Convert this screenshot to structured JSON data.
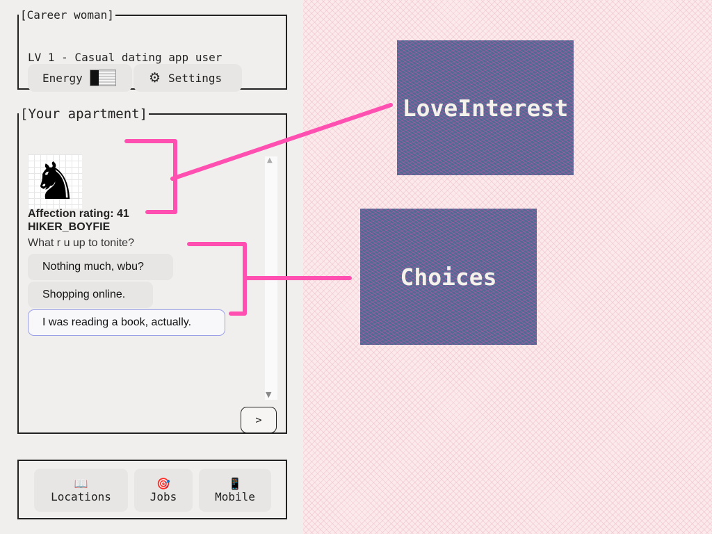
{
  "player": {
    "legend": "[Career woman]",
    "level_text": "LV 1 - Casual dating app user",
    "energy_label": "Energy",
    "energy_level": 0.35,
    "settings_label": "Settings",
    "settings_icon": "gear-icon"
  },
  "apartment": {
    "legend": "[Your apartment]",
    "avatar_icon": "chess-knight-icon",
    "avatar_glyph": "♞",
    "affection_text": "Affection rating: 41",
    "love_interest_name": "HIKER_BOYFIE",
    "message": "What r u up to tonite?",
    "choices": [
      {
        "label": "Nothing much, wbu?",
        "selected": false
      },
      {
        "label": "Shopping online.",
        "selected": false
      },
      {
        "label": "I was reading a book, actually.",
        "selected": true
      }
    ],
    "next_label": ">"
  },
  "nav": [
    {
      "label": "Locations",
      "icon": "book-icon",
      "glyph": "📖"
    },
    {
      "label": "Jobs",
      "icon": "target-icon",
      "glyph": "🎯"
    },
    {
      "label": "Mobile",
      "icon": "phone-icon",
      "glyph": "📱"
    }
  ],
  "annotations": {
    "love_interest": "LoveInterest",
    "choices": "Choices"
  },
  "colors": {
    "marker": "#ff4fb0",
    "callout_bg": "#4f6b93",
    "selected_border": "#9aa0e6"
  }
}
